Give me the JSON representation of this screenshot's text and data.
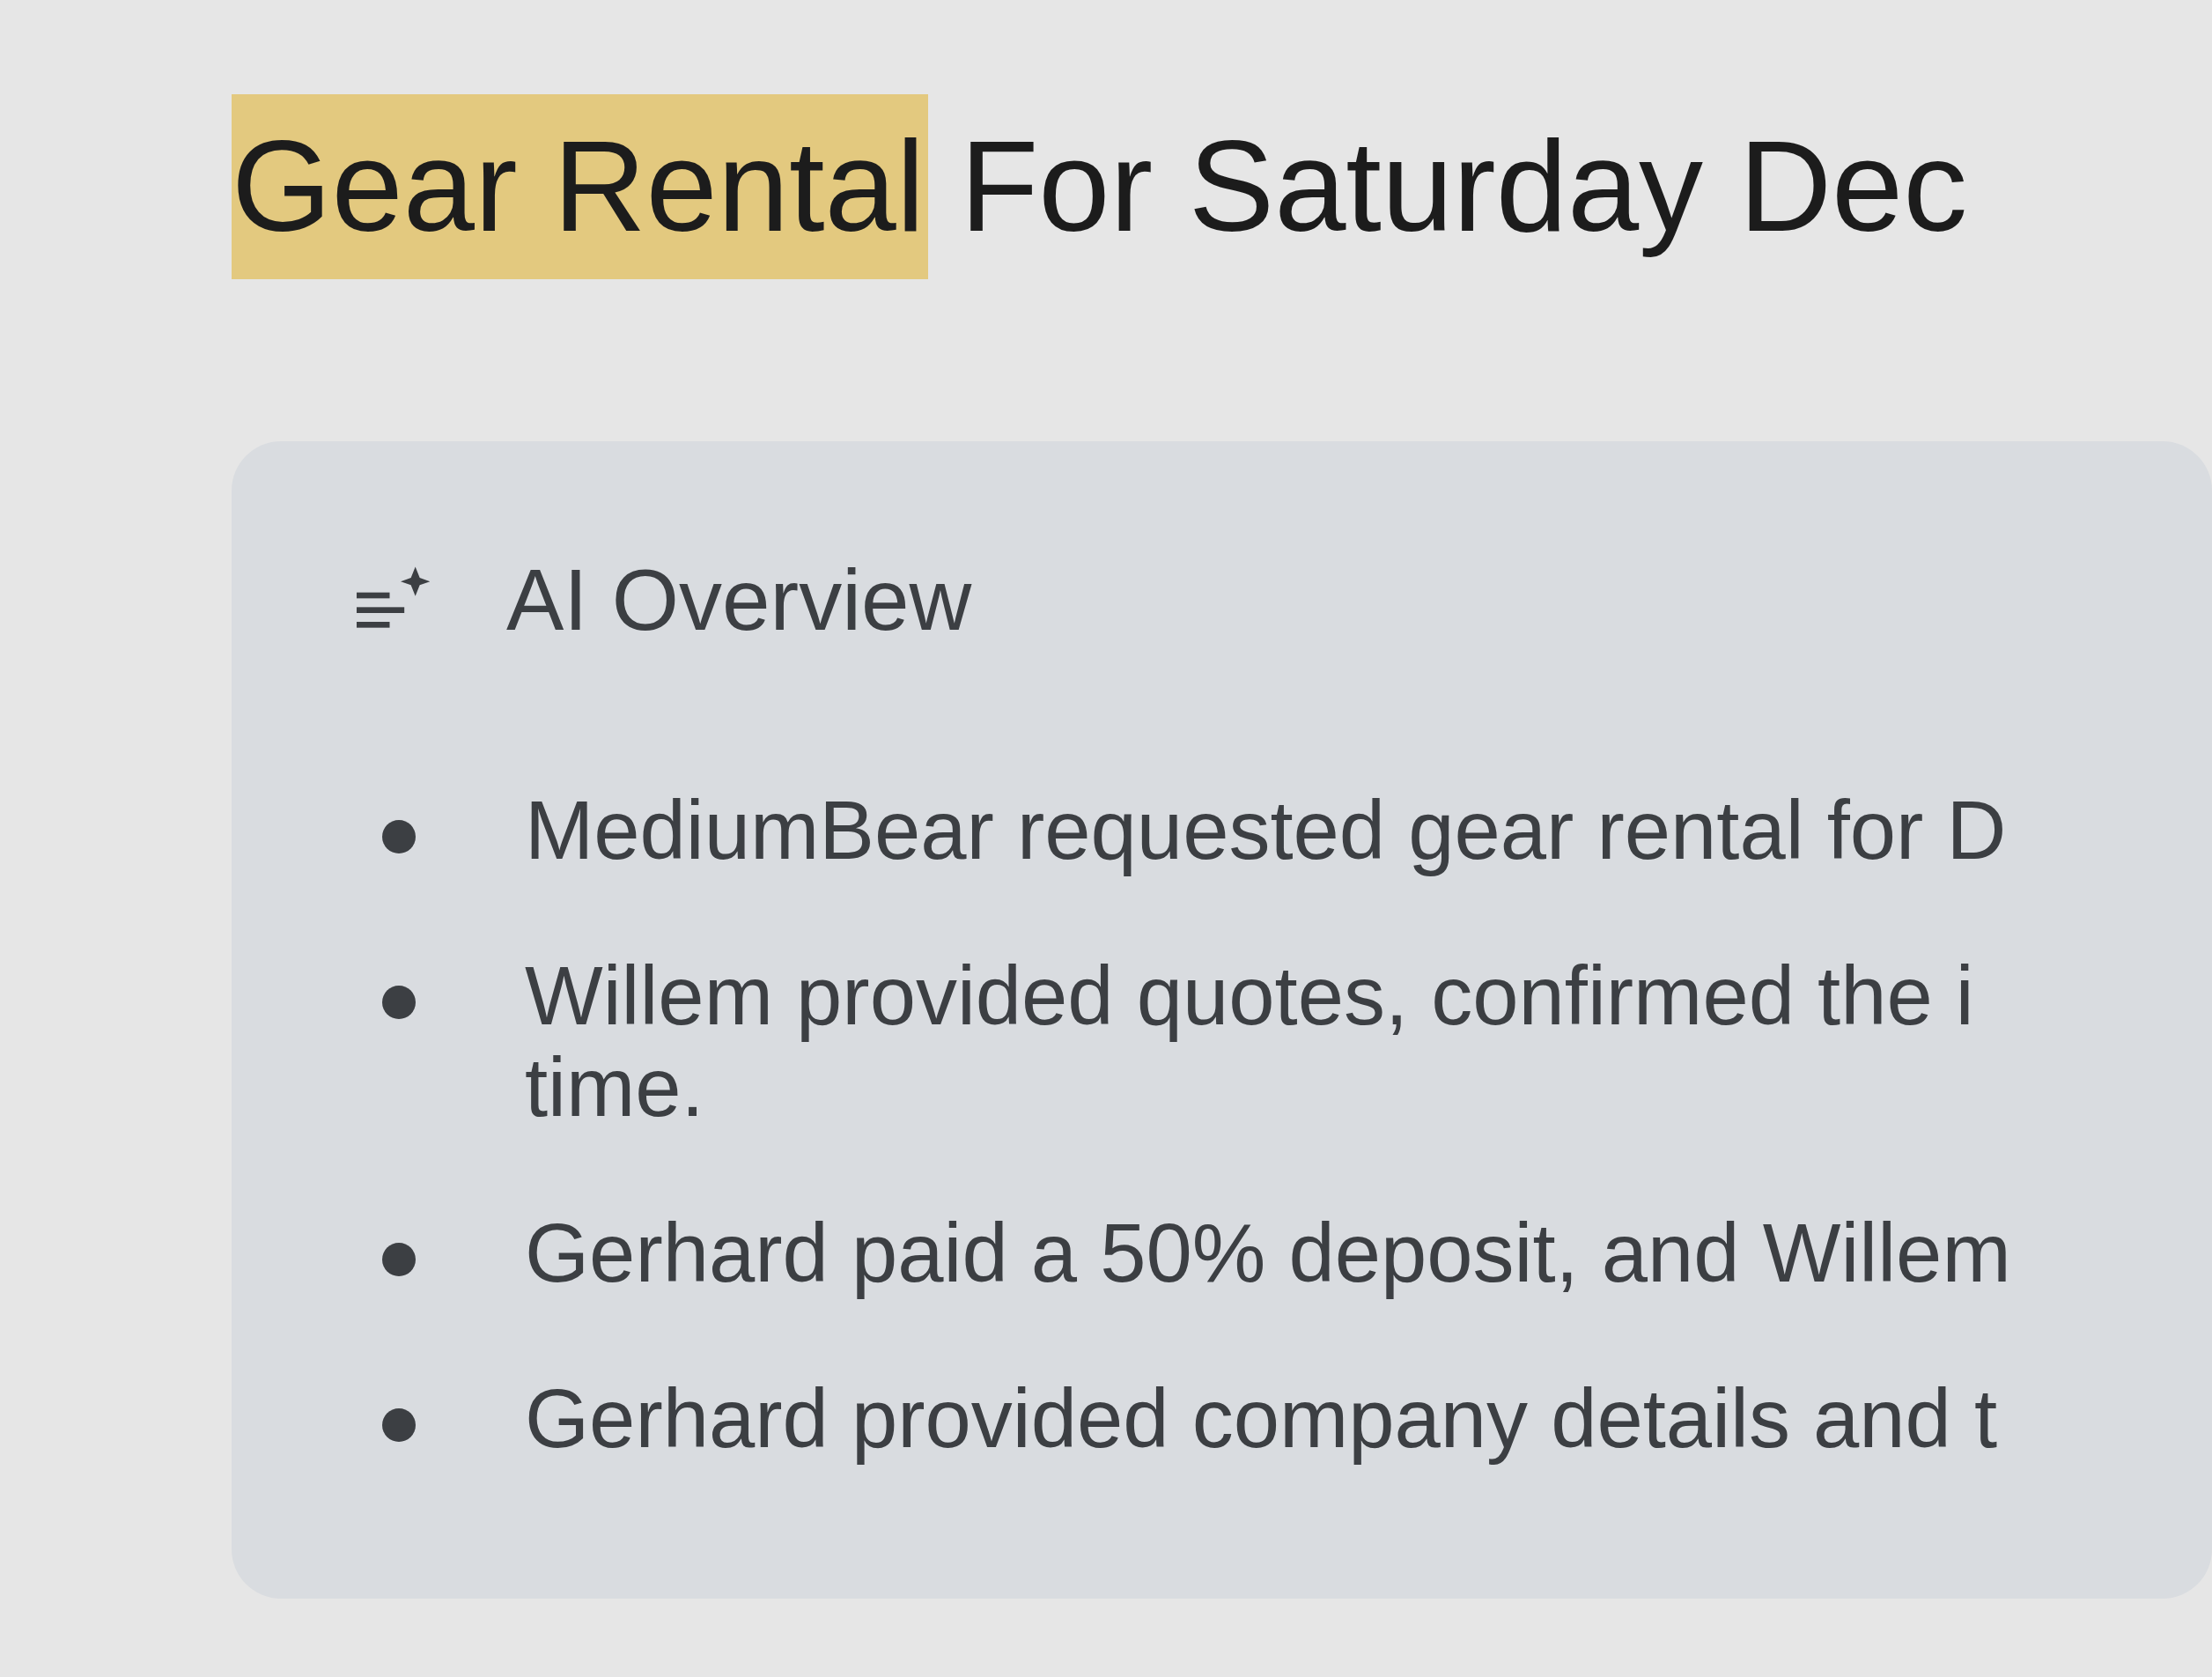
{
  "title": {
    "highlighted": "Gear Rental",
    "rest": "For Saturday Dec"
  },
  "overview": {
    "heading": "AI Overview",
    "bullets": [
      {
        "lines": [
          "MediumBear requested gear rental for D"
        ]
      },
      {
        "lines": [
          "Willem provided quotes, confirmed the i",
          "time."
        ]
      },
      {
        "lines": [
          "Gerhard paid a 50% deposit, and Willem"
        ]
      },
      {
        "lines": [
          "Gerhard provided company details and t"
        ]
      }
    ]
  }
}
